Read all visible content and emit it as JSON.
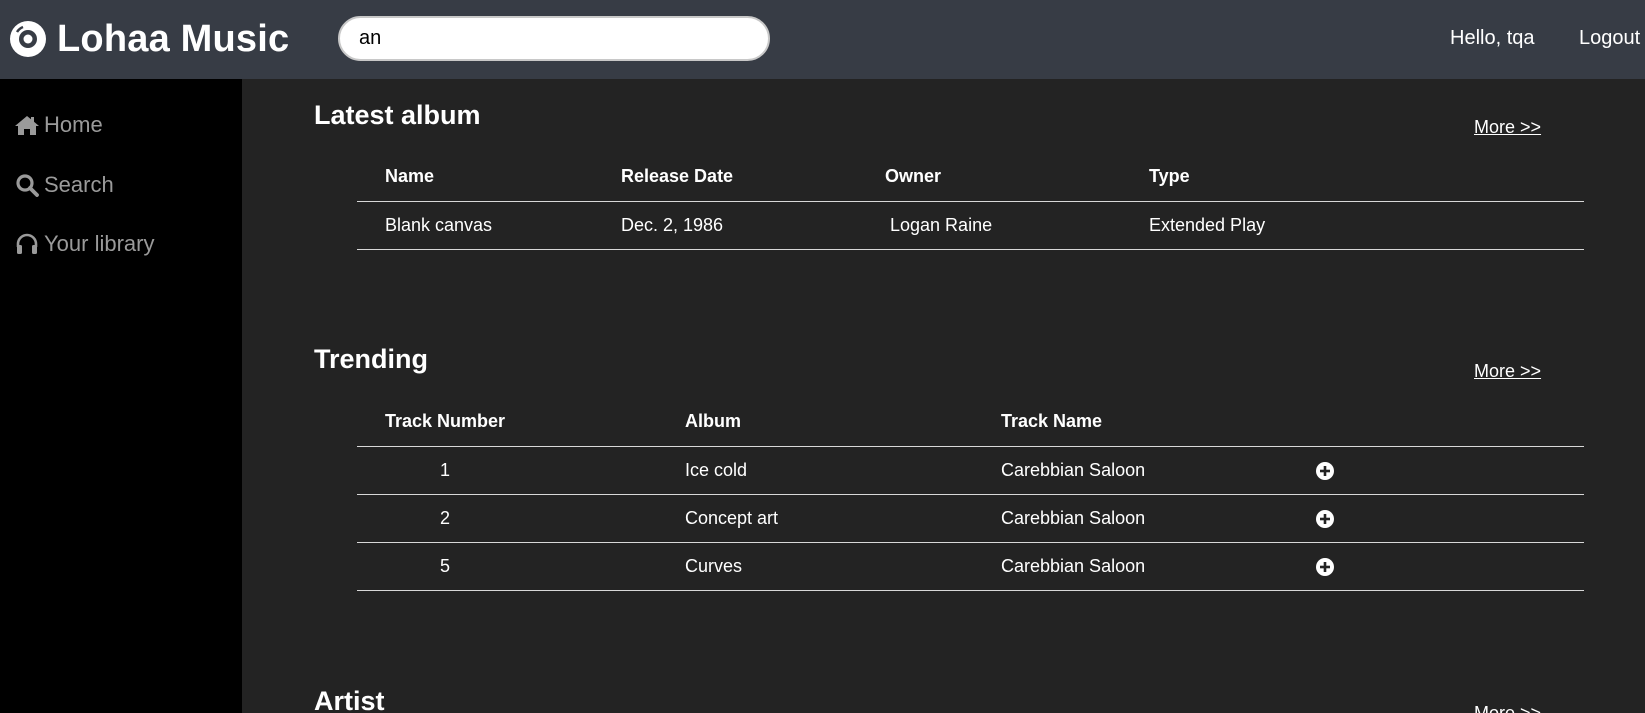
{
  "header": {
    "brand": "Lohaa Music",
    "search_value": "an",
    "greeting": "Hello, tqa",
    "logout": "Logout"
  },
  "sidebar": {
    "items": [
      {
        "label": "Home",
        "icon": "home-icon"
      },
      {
        "label": "Search",
        "icon": "search-icon"
      },
      {
        "label": "Your library",
        "icon": "headphones-icon"
      }
    ]
  },
  "latest_album": {
    "title": "Latest album",
    "more": "More >>",
    "columns": [
      "Name",
      "Release Date",
      "Owner",
      "Type"
    ],
    "rows": [
      {
        "name": "Blank canvas",
        "release_date": "Dec. 2, 1986",
        "owner": "Logan Raine",
        "type": "Extended Play"
      }
    ]
  },
  "trending": {
    "title": "Trending",
    "more": "More >>",
    "columns": [
      "Track Number",
      "Album",
      "Track Name"
    ],
    "rows": [
      {
        "track_number": "1",
        "album": "Ice cold",
        "track_name": "Carebbian Saloon",
        "action_icon": "add-circle-icon"
      },
      {
        "track_number": "2",
        "album": "Concept art",
        "track_name": "Carebbian Saloon",
        "action_icon": "add-circle-icon"
      },
      {
        "track_number": "5",
        "album": "Curves",
        "track_name": "Carebbian Saloon",
        "action_icon": "add-circle-icon"
      }
    ]
  },
  "artist": {
    "title": "Artist",
    "more": "More >>"
  }
}
